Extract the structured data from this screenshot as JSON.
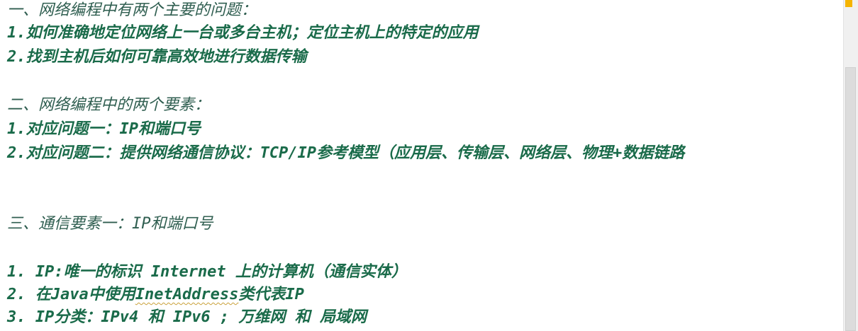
{
  "editor": {
    "lines": [
      "一、网络编程中有两个主要的问题：",
      "1.如何准确地定位网络上一台或多台主机；定位主机上的特定的应用",
      "2.找到主机后如何可靠高效地进行数据传输",
      "二、网络编程中的两个要素：",
      "1.对应问题一：IP和端口号",
      "2.对应问题二：提供网络通信协议：TCP/IP参考模型（应用层、传输层、网络层、物理+数据链路",
      "三、通信要素一：IP和端口号",
      "1. IP:唯一的标识 Internet 上的计算机（通信实体）",
      "2. 在Java中使用",
      "InetAddress",
      "类代表IP",
      "3. IP分类：IPv4 和 IPv6 ; 万维网 和 局域网"
    ]
  }
}
